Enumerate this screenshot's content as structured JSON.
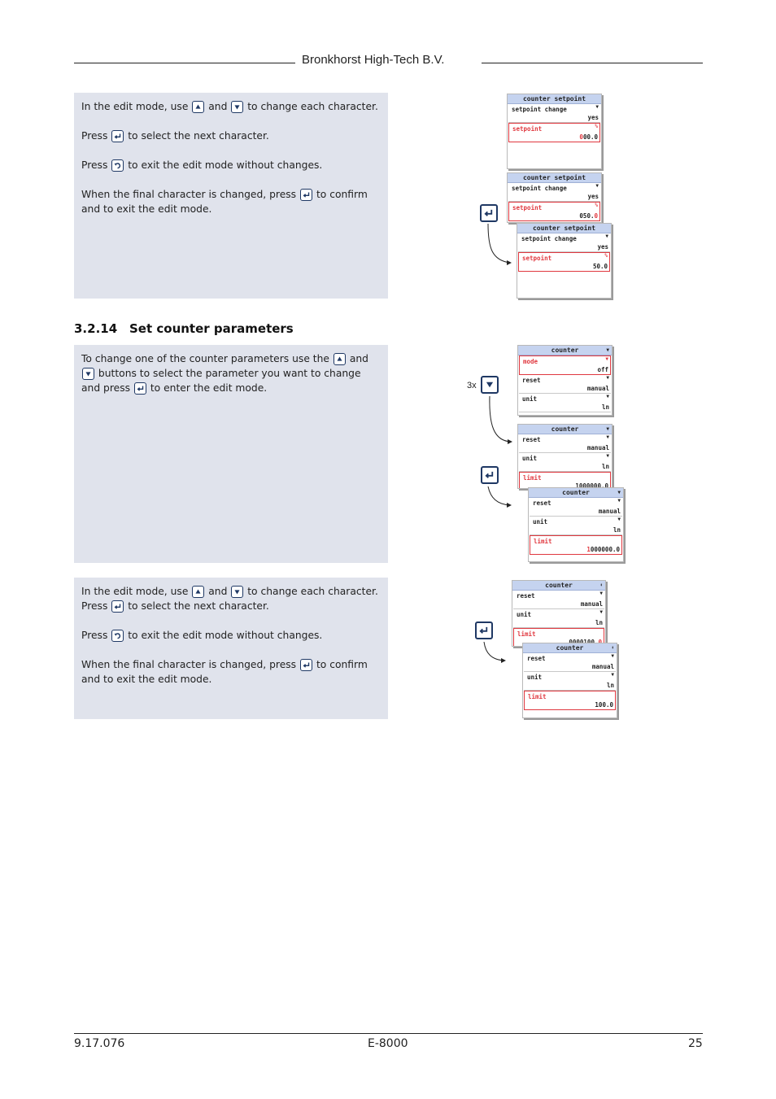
{
  "header": {
    "company": "Bronkhorst High-Tech B.V."
  },
  "footer": {
    "doc_number": "9.17.076",
    "product": "E-8000",
    "page": "25"
  },
  "section": {
    "number": "3.2.14",
    "title": "Set counter parameters"
  },
  "box1": {
    "l1a": "In the edit mode, use",
    "l1b": "and",
    "l1c": "to change each character.",
    "l2a": "Press",
    "l2b": "to select the next character.",
    "l3a": "Press",
    "l3b": "to exit the edit mode without changes.",
    "l4a": "When the final character is changed, press",
    "l4b": "to confirm and to exit the edit mode."
  },
  "box2": {
    "a": "To change one of the counter parameters use the",
    "b": "and",
    "c": "buttons to select the parameter you want to change and press",
    "d": "to enter the edit mode."
  },
  "box3": {
    "l1a": "In the edit mode, use",
    "l1b": "and",
    "l1c": "to change each character.",
    "l2a": "Press",
    "l2b": "to select the next character.",
    "l3a": "Press",
    "l3b": "to exit the edit mode without changes.",
    "l4a": "When the final character is changed, press",
    "l4b": "to confirm and to exit the edit mode."
  },
  "repeat_label": "3x",
  "screens": {
    "s1": {
      "title": "counter setpoint",
      "r1l": "setpoint change",
      "r1v": "yes",
      "r2l": "setpoint",
      "r2i": "%",
      "r2h": "0",
      "r2v": "00.0"
    },
    "s2": {
      "title": "counter setpoint",
      "r1l": "setpoint change",
      "r1v": "yes",
      "r2l": "setpoint",
      "r2i": "%",
      "r2v": "050.",
      "r2h": "0"
    },
    "s3": {
      "title": "counter setpoint",
      "r1l": "setpoint change",
      "r1v": "yes",
      "r2l": "setpoint",
      "r2i": "%",
      "r2v": "50.0"
    },
    "s4": {
      "title": "counter",
      "r1l": "mode",
      "r1v": "off",
      "r2l": "reset",
      "r2v": "manual",
      "r3l": "unit",
      "r3v": "ln"
    },
    "s5": {
      "title": "counter",
      "r1l": "reset",
      "r1v": "manual",
      "r2l": "unit",
      "r2v": "ln",
      "r3l": "limit",
      "r3v": "1000000.0"
    },
    "s6": {
      "title": "counter",
      "r1l": "reset",
      "r1v": "manual",
      "r2l": "unit",
      "r2v": "ln",
      "r3l": "limit",
      "r3h": "1",
      "r3v": "000000.0"
    },
    "s7": {
      "title": "counter",
      "r1l": "reset",
      "r1v": "manual",
      "r2l": "unit",
      "r2v": "ln",
      "r3l": "limit",
      "r3v": "0000100.",
      "r3h": "0"
    },
    "s8": {
      "title": "counter",
      "r1l": "reset",
      "r1v": "manual",
      "r2l": "unit",
      "r2v": "ln",
      "r3l": "limit",
      "r3v": "100.0"
    }
  },
  "icons": {
    "up": "up-arrow-key",
    "down": "down-arrow-key",
    "enter": "enter-key",
    "escape": "back-key",
    "menu_arrow": "▾",
    "scroll_arrow": "⬍"
  }
}
